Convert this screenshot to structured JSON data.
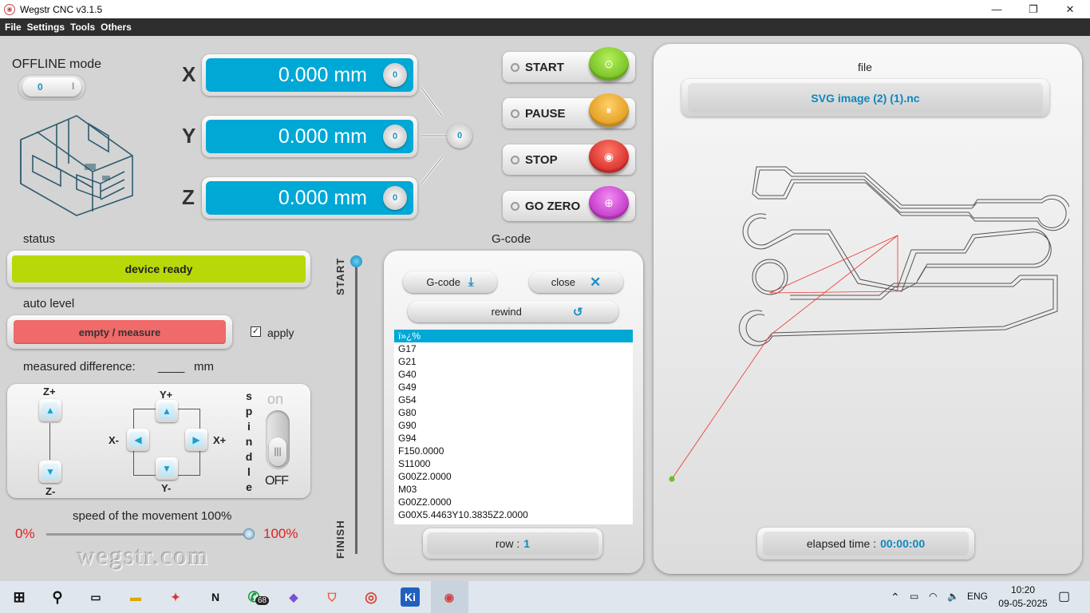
{
  "window": {
    "title": "Wegstr CNC  v3.1.5"
  },
  "menu": [
    "File",
    "Settings",
    "Tools",
    "Others"
  ],
  "offline": {
    "label": "OFFLINE mode",
    "left": "0",
    "right": "I"
  },
  "axes": [
    {
      "name": "X",
      "value": "0.000 mm"
    },
    {
      "name": "Y",
      "value": "0.000 mm"
    },
    {
      "name": "Z",
      "value": "0.000 mm"
    }
  ],
  "axis_knob_symbol": "0",
  "controls": [
    {
      "label": "START",
      "color": "#7fcf1f",
      "icon": "play-icon"
    },
    {
      "label": "PAUSE",
      "color": "#e8a418",
      "icon": "pause-icon"
    },
    {
      "label": "STOP",
      "color": "#e02a2a",
      "icon": "stop-icon"
    },
    {
      "label": "GO ZERO",
      "color": "#d030d0",
      "icon": "target-icon"
    }
  ],
  "status": {
    "label": "status",
    "value": "device ready",
    "color": "#b9d80a"
  },
  "auto_level": {
    "label": "auto level",
    "button": "empty / measure",
    "apply_label": "apply",
    "apply_checked": true
  },
  "measured": {
    "label": "measured difference:",
    "value": "____",
    "unit": "mm"
  },
  "jog": {
    "z_plus": "Z+",
    "z_minus": "Z-",
    "y_plus": "Y+",
    "y_minus": "Y-",
    "x_minus": "X-",
    "x_plus": "X+",
    "spindle_letters": [
      "s",
      "p",
      "i",
      "n",
      "d",
      "l",
      "e"
    ],
    "spindle_on": "on",
    "spindle_off": "OFF"
  },
  "speed": {
    "label": "speed of the movement 100%",
    "min": "0%",
    "max": "100%",
    "percent": 100
  },
  "watermark": "wegstr.com",
  "progress": {
    "start": "START",
    "finish": "FINISH",
    "position": 0
  },
  "gcode": {
    "title": "G-code",
    "load_label": "G-code",
    "close_label": "close",
    "rewind_label": "rewind",
    "lines": [
      "ï»¿%",
      "G17",
      "G21",
      "G40",
      "G49",
      "G54",
      "G80",
      "G90",
      "G94",
      "F150.0000",
      "S11000",
      "G00Z2.0000",
      "M03",
      "G00Z2.0000",
      "G00X5.4463Y10.3835Z2.0000"
    ],
    "row_label": "row :",
    "row_value": "1"
  },
  "file": {
    "label": "file",
    "name": "SVG image (2) (1).nc",
    "elapsed_label": "elapsed time :",
    "elapsed_value": "00:00:00"
  },
  "taskbar": {
    "whatsapp_badge": "68",
    "lang": "ENG",
    "time": "10:20",
    "date": "09-05-2025"
  }
}
